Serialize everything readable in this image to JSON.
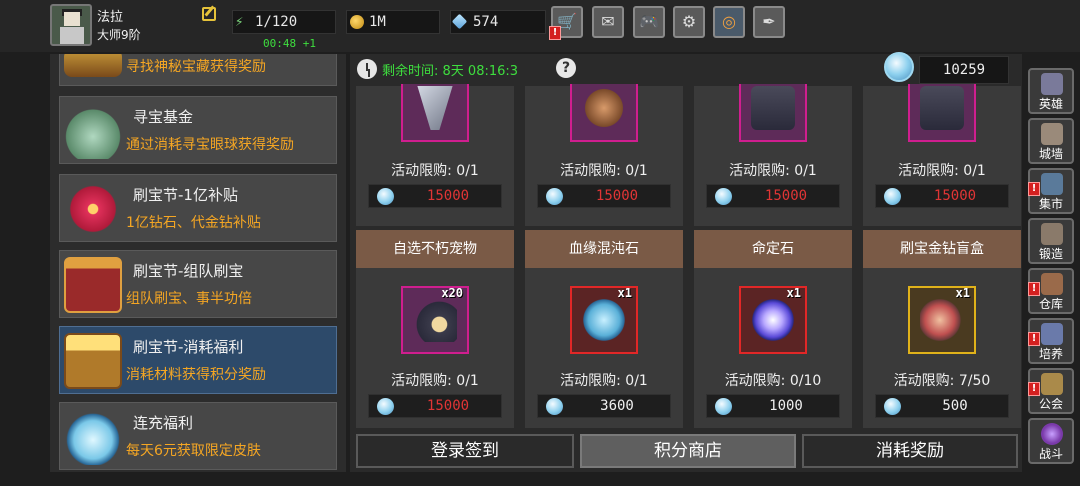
{
  "player": {
    "name": "法拉",
    "rank": "大师9阶"
  },
  "resources": {
    "stamina": "1/120",
    "stamina_timer": "00:48 +1",
    "gold": "1M",
    "gems": "574"
  },
  "top_buttons": [
    {
      "name": "shop-cart",
      "icon": "🛒",
      "alert": "!"
    },
    {
      "name": "mail",
      "icon": "✉"
    },
    {
      "name": "gamepad",
      "icon": "🎮"
    },
    {
      "name": "settings",
      "icon": "⚙"
    },
    {
      "name": "color-wheel",
      "icon": "◎"
    },
    {
      "name": "feather",
      "icon": "✒"
    }
  ],
  "left_list": [
    {
      "title": "",
      "desc": "寻找神秘宝藏获得奖励"
    },
    {
      "title": "寻宝基金",
      "desc": "通过消耗寻宝眼球获得奖励"
    },
    {
      "title": "刷宝节-1亿补贴",
      "desc": "1亿钻石、代金钻补贴"
    },
    {
      "title": "刷宝节-组队刷宝",
      "desc": "组队刷宝、事半功倍"
    },
    {
      "title": "刷宝节-消耗福利",
      "desc": "消耗材料获得积分奖励"
    },
    {
      "title": "连充福利",
      "desc": "每天6元获取限定皮肤"
    }
  ],
  "countdown": {
    "label": "剩余时间:",
    "value": "8天 08:16:3"
  },
  "score": "10259",
  "top_row": [
    {
      "limit": "活动限购: 0/1",
      "price": "15000"
    },
    {
      "limit": "活动限购: 0/1",
      "price": "15000"
    },
    {
      "limit": "活动限购: 0/1",
      "price": "15000"
    },
    {
      "limit": "活动限购: 0/1",
      "price": "15000"
    }
  ],
  "bottom_row": [
    {
      "title": "自选不朽宠物",
      "qty": "x20",
      "limit": "活动限购: 0/1",
      "price": "15000",
      "price_red": true
    },
    {
      "title": "血缘混沌石",
      "qty": "x1",
      "limit": "活动限购: 0/1",
      "price": "3600",
      "price_red": false
    },
    {
      "title": "命定石",
      "qty": "x1",
      "limit": "活动限购: 0/10",
      "price": "1000",
      "price_red": false
    },
    {
      "title": "刷宝金钻盲盒",
      "qty": "x1",
      "limit": "活动限购: 7/50",
      "price": "500",
      "price_red": false
    }
  ],
  "tabs": {
    "signin": "登录签到",
    "shop": "积分商店",
    "consume": "消耗奖励"
  },
  "side_nav": [
    {
      "label": "英雄",
      "color": "#7a7a9a",
      "alert": ""
    },
    {
      "label": "城墙",
      "color": "#9a8a7a",
      "alert": ""
    },
    {
      "label": "集市",
      "color": "#5a7a9a",
      "alert": "!"
    },
    {
      "label": "锻造",
      "color": "#8a7a6a",
      "alert": ""
    },
    {
      "label": "仓库",
      "color": "#9a6a4a",
      "alert": "!"
    },
    {
      "label": "培养",
      "color": "#6a7aaa",
      "alert": "!"
    },
    {
      "label": "公会",
      "color": "#aa8a4a",
      "alert": "!"
    },
    {
      "label": "战斗",
      "color": "#7a3aaa",
      "alert": ""
    }
  ]
}
